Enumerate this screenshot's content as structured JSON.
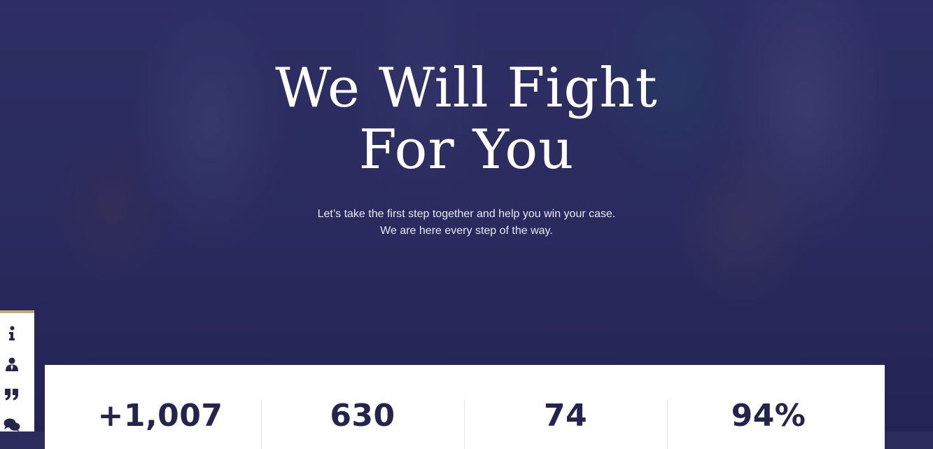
{
  "hero": {
    "title_line1": "We Will Fight",
    "title_line2": "For You",
    "subtitle_line1": "Let’s take the first step together and help you win your case.",
    "subtitle_line2": "We are here every step of the way."
  },
  "side_nav": {
    "accent_color": "#c9a96a",
    "items": [
      {
        "icon": "info-icon"
      },
      {
        "icon": "lawyer-icon"
      },
      {
        "icon": "quote-icon"
      },
      {
        "icon": "comments-icon"
      }
    ]
  },
  "stats": [
    {
      "value": "+1,007"
    },
    {
      "value": "630"
    },
    {
      "value": "74"
    },
    {
      "value": "94%"
    }
  ],
  "colors": {
    "brand_navy": "#24244f",
    "accent_gold": "#c9a96a"
  }
}
